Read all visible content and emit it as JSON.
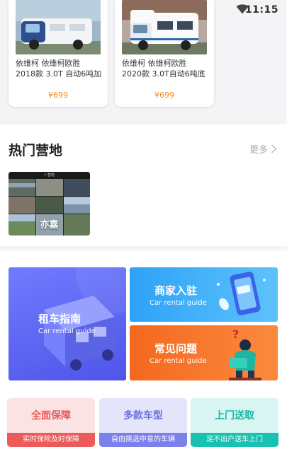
{
  "status_bar": {
    "time": "11:15"
  },
  "cars": [
    {
      "title": "依维柯 依维柯欧胜 2018款 3.0T 自动6吨加长轴...",
      "price": "¥699"
    },
    {
      "title": "依维柯 依维柯欧胜 2020款 3.0T自动6吨底盘加...",
      "price": "¥699"
    }
  ],
  "hot_camps": {
    "title": "热门营地",
    "more_label": "更多",
    "camps": [
      {
        "name": "亦嘉",
        "banner_text": "♪ 营地"
      }
    ]
  },
  "guides": {
    "rental_guide": {
      "title": "租车指南",
      "subtitle": "Car rental guide"
    },
    "merchant": {
      "title": "商家入驻",
      "subtitle": "Car rental guide"
    },
    "faq": {
      "title": "常见问题",
      "subtitle": "Car rental guide"
    }
  },
  "features": [
    {
      "title": "全面保障",
      "caption": "实时保险及时保障"
    },
    {
      "title": "多款车型",
      "caption": "自由挑选中意的车辆"
    },
    {
      "title": "上门送取",
      "caption": "足不出户送车上门"
    }
  ],
  "colors": {
    "price": "#f08a24",
    "guide_blue": "#5a62f0",
    "merchant_blue": "#3aaaf8",
    "faq_orange": "#f6732a",
    "feature_red": "#ec5a5a",
    "feature_purple": "#7b80ea",
    "feature_teal": "#18c1b1"
  }
}
